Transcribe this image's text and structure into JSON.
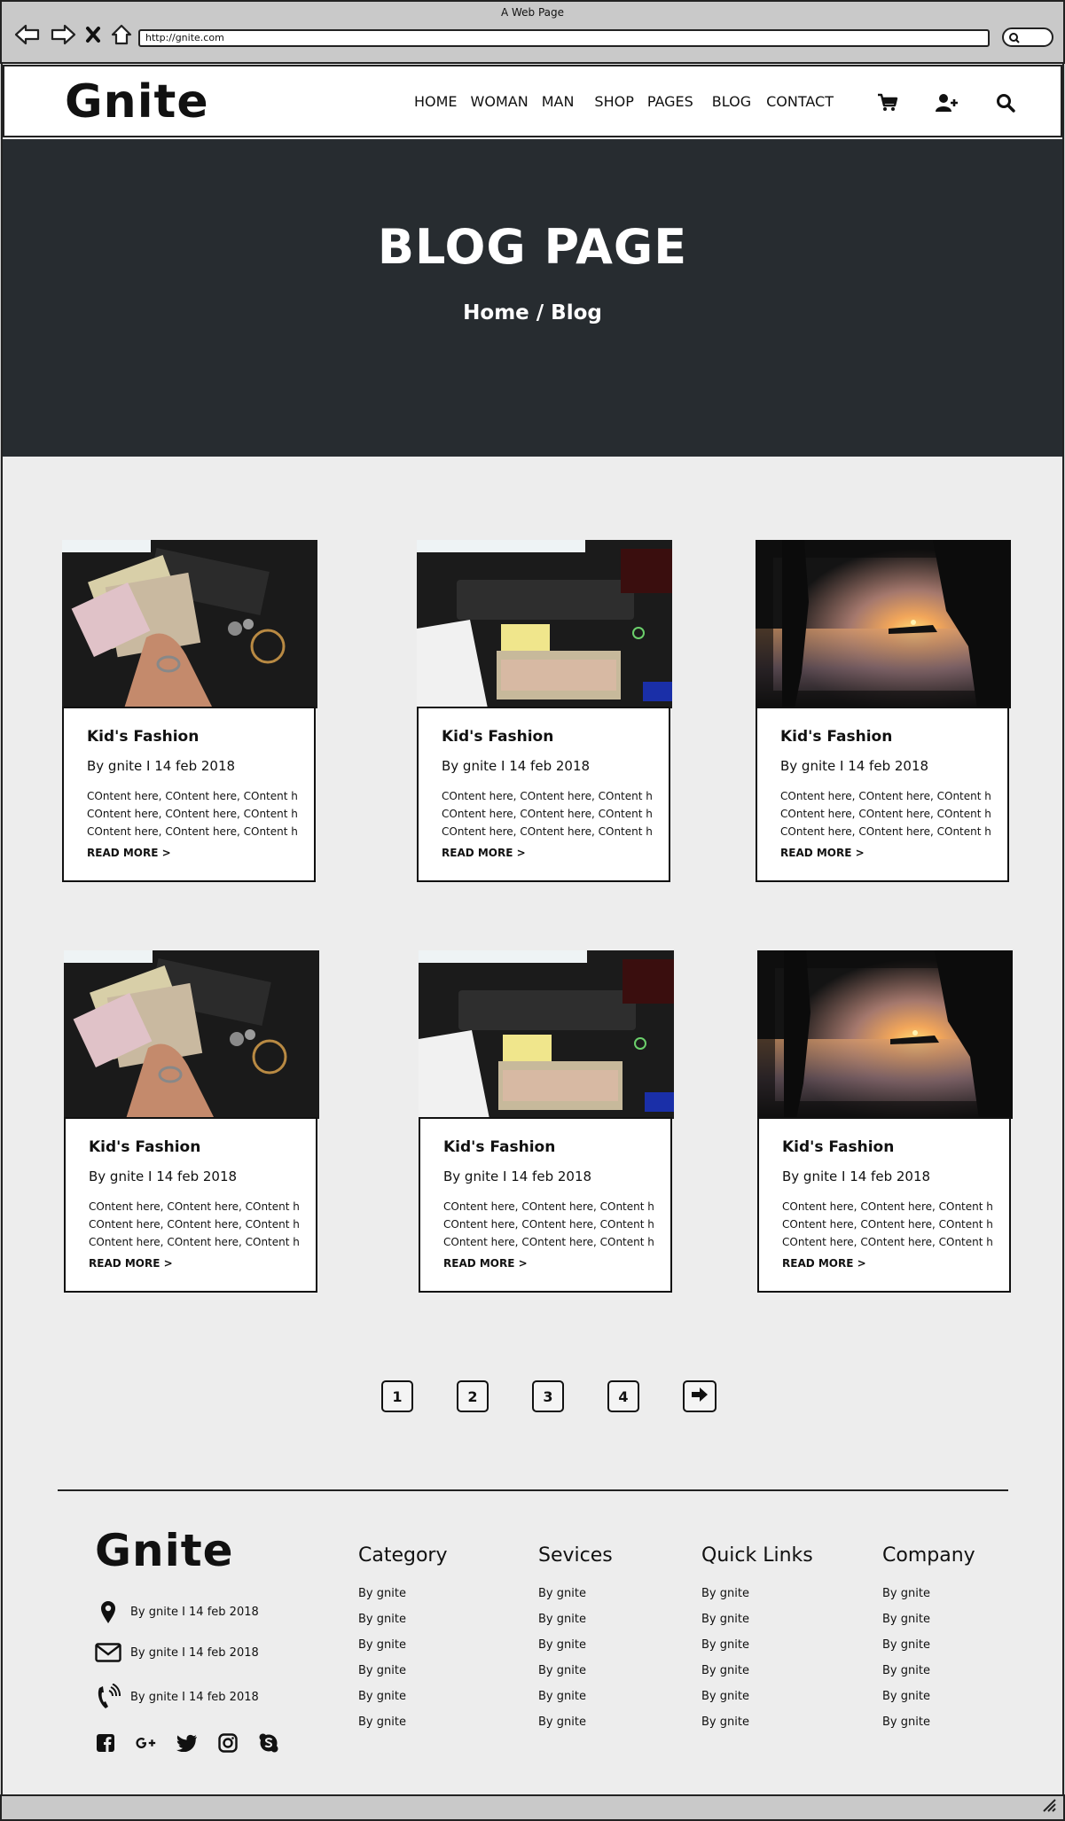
{
  "browser": {
    "title": "A Web Page",
    "url": "http://gnite.com"
  },
  "header": {
    "logo": "Gnite",
    "nav": [
      "HOME",
      "WOMAN",
      "MAN",
      "SHOP",
      "PAGES",
      "BLOG",
      "CONTACT"
    ],
    "icons": [
      "cart-icon",
      "add-user-icon",
      "search-icon"
    ]
  },
  "hero": {
    "title": "BLOG PAGE",
    "breadcrumb": "Home / Blog"
  },
  "posts": [
    {
      "title": "Kid's Fashion",
      "meta": "By gnite I 14 feb 2018",
      "lines": [
        "COntent here, COntent here, COntent here",
        "COntent here, COntent here, COntent here",
        "COntent here, COntent here, COntent here"
      ],
      "link": "READ MORE >",
      "image": "money-photo"
    },
    {
      "title": "Kid's Fashion",
      "meta": "By gnite I 14 feb 2018",
      "lines": [
        "COntent here, COntent here, COntent here",
        "COntent here, COntent here, COntent here",
        "COntent here, COntent here, COntent here"
      ],
      "link": "READ MORE >",
      "image": "keyboard-money-photo"
    },
    {
      "title": "Kid's Fashion",
      "meta": "By gnite I 14 feb 2018",
      "lines": [
        "COntent here, COntent here, COntent here",
        "COntent here, COntent here, COntent here",
        "COntent here, COntent here, COntent here"
      ],
      "link": "READ MORE >",
      "image": "sunset-photo"
    },
    {
      "title": "Kid's Fashion",
      "meta": "By gnite I 14 feb 2018",
      "lines": [
        "COntent here, COntent here, COntent here",
        "COntent here, COntent here, COntent here",
        "COntent here, COntent here, COntent here"
      ],
      "link": "READ MORE >",
      "image": "money-photo"
    },
    {
      "title": "Kid's Fashion",
      "meta": "By gnite I 14 feb 2018",
      "lines": [
        "COntent here, COntent here, COntent here",
        "COntent here, COntent here, COntent here",
        "COntent here, COntent here, COntent here"
      ],
      "link": "READ MORE >",
      "image": "keyboard-money-photo"
    },
    {
      "title": "Kid's Fashion",
      "meta": "By gnite I 14 feb 2018",
      "lines": [
        "COntent here, COntent here, COntent here",
        "COntent here, COntent here, COntent here",
        "COntent here, COntent here, COntent here"
      ],
      "link": "READ MORE >",
      "image": "sunset-photo"
    }
  ],
  "pagination": {
    "pages": [
      "1",
      "2",
      "3",
      "4"
    ],
    "next_icon": "arrow-right-icon"
  },
  "footer": {
    "logo": "Gnite",
    "contact": [
      {
        "icon": "map-pin-icon",
        "text": "By gnite I 14 feb 2018"
      },
      {
        "icon": "envelope-icon",
        "text": "By gnite I 14 feb 2018"
      },
      {
        "icon": "phone-icon",
        "text": "By gnite I 14 feb 2018"
      }
    ],
    "social": [
      "facebook-icon",
      "google-plus-icon",
      "twitter-icon",
      "instagram-icon",
      "skype-icon"
    ],
    "columns": [
      {
        "title": "Category",
        "items": [
          "By gnite",
          "By gnite",
          "By gnite",
          "By gnite",
          "By gnite",
          "By gnite"
        ]
      },
      {
        "title": "Sevices",
        "items": [
          "By gnite",
          "By gnite",
          "By gnite",
          "By gnite",
          "By gnite",
          "By gnite"
        ]
      },
      {
        "title": "Quick Links",
        "items": [
          "By gnite",
          "By gnite",
          "By gnite",
          "By gnite",
          "By gnite",
          "By gnite"
        ]
      },
      {
        "title": "Company",
        "items": [
          "By gnite",
          "By gnite",
          "By gnite",
          "By gnite",
          "By gnite",
          "By gnite"
        ]
      }
    ]
  }
}
